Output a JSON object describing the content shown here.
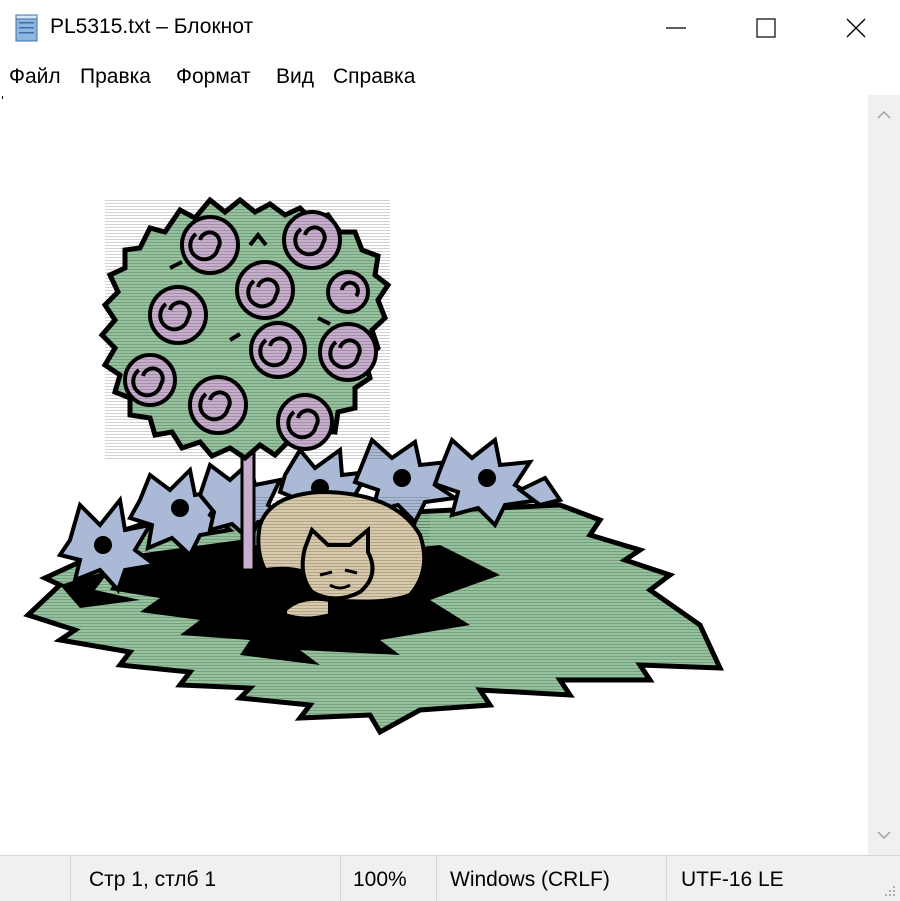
{
  "window": {
    "title": "PL5315.txt – Блокнот",
    "minimize_icon": "minimize-icon",
    "maximize_icon": "maximize-icon",
    "close_icon": "close-icon"
  },
  "menu": {
    "items": [
      "Файл",
      "Правка",
      "Формат",
      "Вид",
      "Справка"
    ]
  },
  "status": {
    "position": "Стр 1, стлб 1",
    "zoom": "100%",
    "line_ending": "Windows (CRLF)",
    "encoding": "UTF-16 LE"
  },
  "colors": {
    "leaf_green": "#94c29c",
    "rose_purple": "#c7aecc",
    "flower_blue": "#a9b9d6",
    "cat_tan": "#d8c9aa",
    "outline": "#000000",
    "scrollbar": "#f0f0f0"
  }
}
